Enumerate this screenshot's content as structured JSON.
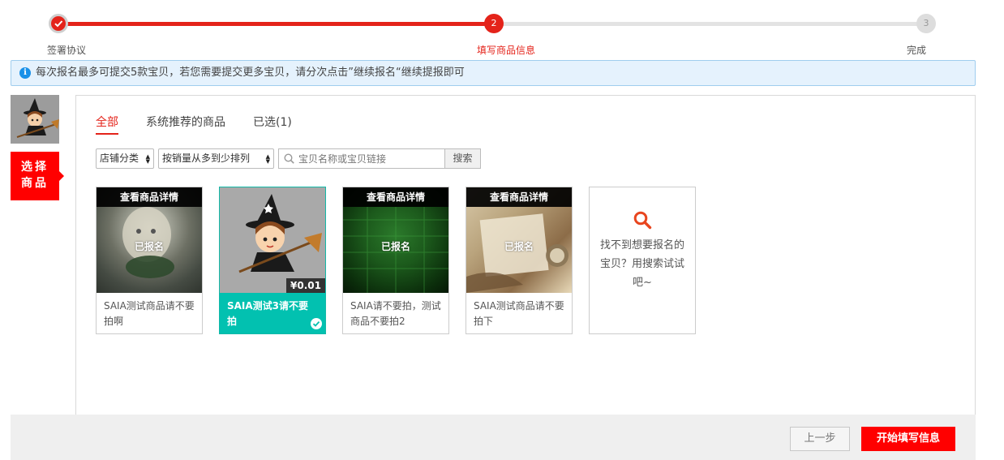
{
  "stepper": {
    "steps": [
      {
        "number": "",
        "label": "签署协议",
        "state": "done"
      },
      {
        "number": "2",
        "label": "填写商品信息",
        "state": "current"
      },
      {
        "number": "3",
        "label": "完成",
        "state": "pending"
      }
    ],
    "accent_color": "#e4231a"
  },
  "notice": {
    "text": "每次报名最多可提交5款宝贝，若您需要提交更多宝贝，请分次点击”继续报名“继续提报即可"
  },
  "side": {
    "tab_line1": "选择",
    "tab_line2": "商品"
  },
  "tabs": [
    {
      "label": "全部",
      "active": true
    },
    {
      "label": "系统推荐的商品",
      "active": false
    },
    {
      "label": "已选(1)",
      "active": false
    }
  ],
  "filters": {
    "shop_category": "店铺分类",
    "sort": "按销量从多到少排列",
    "search_placeholder": "宝贝名称或宝贝链接",
    "search_button": "搜索"
  },
  "products": [
    {
      "head": "查看商品详情",
      "status": "已报名",
      "title": "SAIA测试商品请不要拍啊"
    },
    {
      "price": "¥0.01",
      "title": "SAIA测试3请不要拍",
      "selected": true
    },
    {
      "head": "查看商品详情",
      "status": "已报名",
      "title": "SAIA请不要拍，测试商品不要拍2"
    },
    {
      "head": "查看商品详情",
      "status": "已报名",
      "title": "SAIA测试商品请不要拍下"
    }
  ],
  "search_card": {
    "text": "找不到想要报名的宝贝？用搜索试试吧~",
    "icon": "search-icon"
  },
  "bottom": {
    "prev_label": "上一步",
    "start_label": "开始填写信息"
  }
}
